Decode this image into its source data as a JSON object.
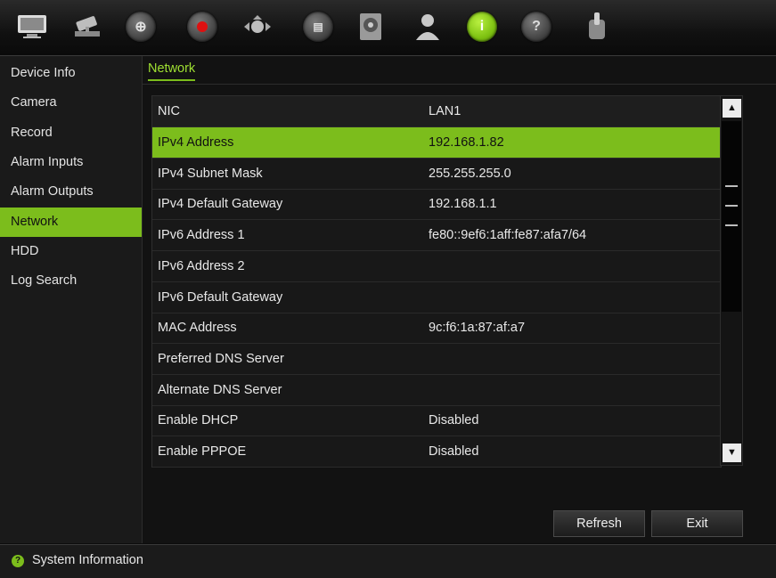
{
  "toolbar": {
    "icons": [
      {
        "name": "monitor-icon",
        "glyph": "▭"
      },
      {
        "name": "camera-icon",
        "glyph": "◆"
      },
      {
        "name": "network-icon",
        "glyph": "⊕"
      },
      {
        "name": "record-icon",
        "glyph": "●"
      },
      {
        "name": "ptz-icon",
        "glyph": "◈"
      },
      {
        "name": "tape-icon",
        "glyph": "▤"
      },
      {
        "name": "hdd-icon",
        "glyph": "◎"
      },
      {
        "name": "user-icon",
        "glyph": "♙"
      },
      {
        "name": "info-icon",
        "glyph": "i"
      },
      {
        "name": "help-icon",
        "glyph": "?"
      },
      {
        "name": "power-icon",
        "glyph": "⏻"
      }
    ],
    "active_index": 8
  },
  "sidebar": {
    "items": [
      {
        "label": "Device Info"
      },
      {
        "label": "Camera"
      },
      {
        "label": "Record"
      },
      {
        "label": "Alarm Inputs"
      },
      {
        "label": "Alarm Outputs"
      },
      {
        "label": "Network"
      },
      {
        "label": "HDD"
      },
      {
        "label": "Log Search"
      }
    ],
    "active_label": "Network"
  },
  "main": {
    "tab": "Network",
    "table": {
      "header": {
        "key": "NIC",
        "value": "LAN1"
      },
      "rows": [
        {
          "key": "IPv4 Address",
          "value": "192.168.1.82"
        },
        {
          "key": "IPv4 Subnet Mask",
          "value": "255.255.255.0"
        },
        {
          "key": "IPv4 Default Gateway",
          "value": "192.168.1.1"
        },
        {
          "key": "IPv6 Address 1",
          "value": "fe80::9ef6:1aff:fe87:afa7/64"
        },
        {
          "key": "IPv6 Address 2",
          "value": ""
        },
        {
          "key": "IPv6 Default Gateway",
          "value": ""
        },
        {
          "key": "MAC Address",
          "value": "9c:f6:1a:87:af:a7"
        },
        {
          "key": "Preferred DNS Server",
          "value": ""
        },
        {
          "key": "Alternate DNS Server",
          "value": ""
        },
        {
          "key": "Enable DHCP",
          "value": "Disabled"
        },
        {
          "key": "Enable PPPOE",
          "value": "Disabled"
        }
      ],
      "selected_row": 0
    },
    "buttons": {
      "refresh": "Refresh",
      "exit": "Exit"
    }
  },
  "statusbar": {
    "text": "System Information",
    "icon": "help-icon"
  },
  "colors": {
    "accent": "#7cbd1c",
    "background": "#0c0c0c"
  }
}
